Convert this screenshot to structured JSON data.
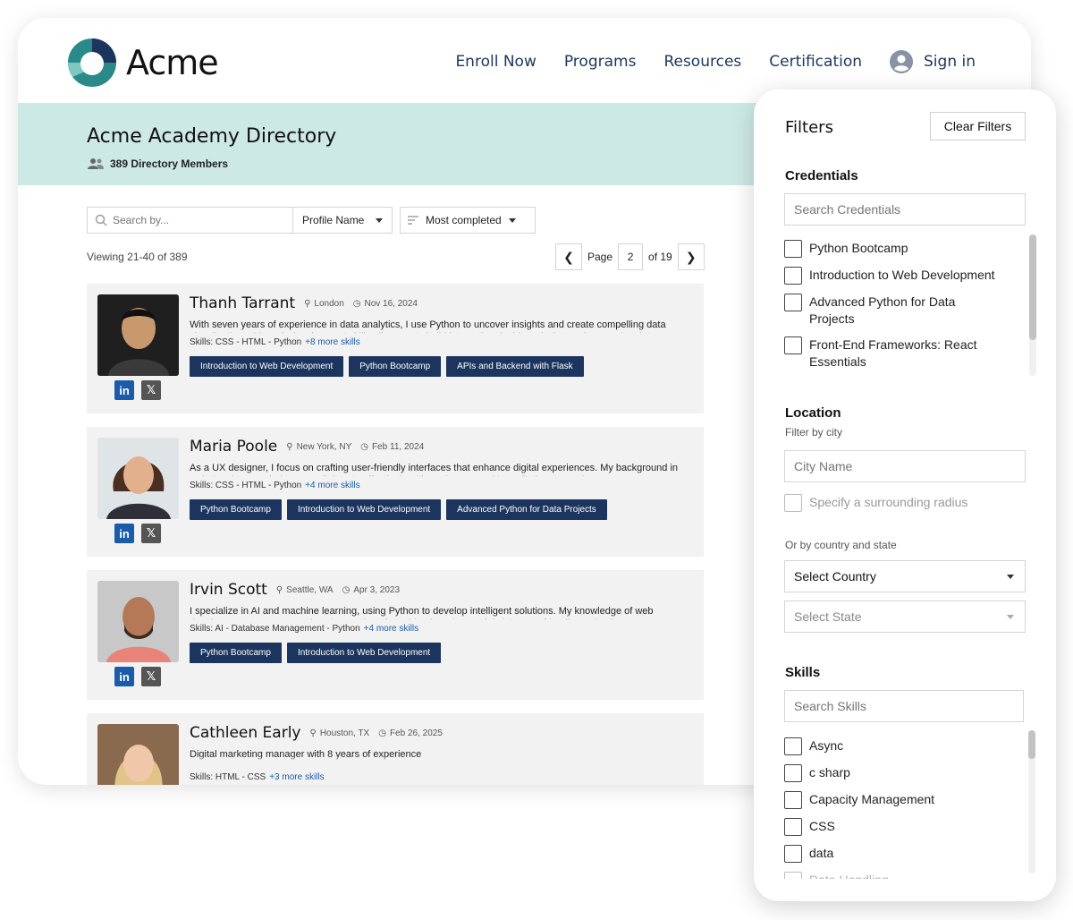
{
  "brand": {
    "name": "Acme"
  },
  "nav": {
    "enroll": "Enroll Now",
    "programs": "Programs",
    "resources": "Resources",
    "certification": "Certification",
    "signin": "Sign in"
  },
  "directory": {
    "title": "Acme Academy Directory",
    "members": "389 Directory Members"
  },
  "toolbar": {
    "search_placeholder": "Search by...",
    "search_field": "Profile Name",
    "sort": "Most completed"
  },
  "results": {
    "viewing": "Viewing 21-40 of 389",
    "page_label": "Page",
    "page_value": "2",
    "page_of": "of 19"
  },
  "members": [
    {
      "name": "Thanh Tarrant",
      "location": "London",
      "date": "Nov 16, 2024",
      "bio": "With seven years of experience in data analytics, I use Python to uncover insights and create compelling data visualizations. My web development skills allow me to build interactive dashboards that make complex data",
      "skills": "Skills: CSS - HTML - Python",
      "more": "+8 more skills",
      "tags": [
        "Introduction to Web Development",
        "Python Bootcamp",
        "APIs and Backend with Flask"
      ]
    },
    {
      "name": "Maria Poole",
      "location": "New York, NY",
      "date": "Feb 11, 2024",
      "bio": "As a UX designer, I focus on crafting user-friendly interfaces that enhance digital experiences. My background in web development helps me collaborate effectively with engineers, and I use Python to analyze",
      "skills": "Skills: CSS - HTML - Python",
      "more": "+4 more skills",
      "tags": [
        "Python Bootcamp",
        "Introduction to Web Development",
        "Advanced Python for Data Projects"
      ]
    },
    {
      "name": "Irvin Scott",
      "location": "Seattle, WA",
      "date": "Apr 3, 2023",
      "bio": "I specialize in AI and machine learning, using Python to develop intelligent solutions. My knowledge of web development ensures seamless integration of machine learning models into user-friendly applications.",
      "skills": "Skills: AI - Database Management - Python",
      "more": "+4 more skills",
      "tags": [
        "Python Bootcamp",
        "Introduction to Web Development"
      ]
    },
    {
      "name": "Cathleen Early",
      "location": "Houston, TX",
      "date": "Feb 26, 2025",
      "bio": "Digital marketing manager with 8 years of experience",
      "skills": "Skills: HTML - CSS",
      "more": "+3 more skills",
      "tags": []
    }
  ],
  "filters": {
    "title": "Filters",
    "clear": "Clear Filters",
    "credentials": {
      "heading": "Credentials",
      "placeholder": "Search Credentials",
      "items": [
        "Python Bootcamp",
        "Introduction to Web Development",
        "Advanced Python for Data Projects",
        "Front-End Frameworks: React Essentials"
      ]
    },
    "location": {
      "heading": "Location",
      "sub": "Filter by city",
      "city_placeholder": "City Name",
      "radius": "Specify a surrounding radius",
      "country_label": "Or by country and state",
      "country": "Select Country",
      "state": "Select State"
    },
    "skills": {
      "heading": "Skills",
      "placeholder": "Search Skills",
      "items": [
        "Async",
        "c sharp",
        "Capacity Management",
        "CSS",
        "data",
        "Data Handling"
      ]
    }
  },
  "colors": {
    "navy": "#1c355e",
    "teal_banner": "#cde9e6",
    "link_blue": "#1a5cab"
  }
}
